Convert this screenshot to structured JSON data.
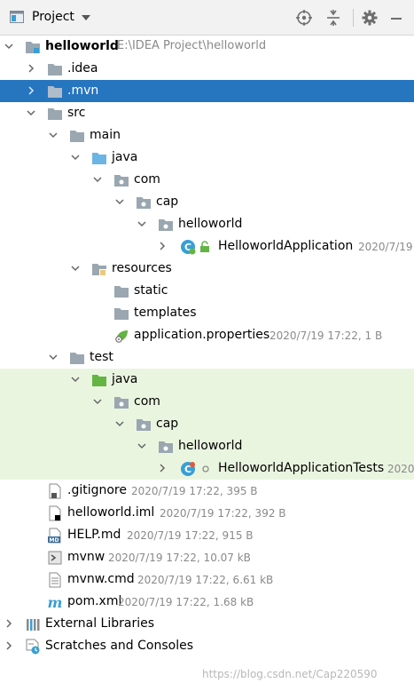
{
  "header": {
    "title": "Project",
    "icons": [
      "project-panel-icon",
      "chevron-down-icon",
      "locate-icon",
      "collapse-all-icon",
      "gear-icon",
      "minimize-icon"
    ]
  },
  "tree": {
    "root_label": "helloworld",
    "root_path": "E:\\IDEA Project\\helloworld",
    "idea": ".idea",
    "mvn": ".mvn",
    "src": "src",
    "main": "main",
    "main_java": "java",
    "main_com": "com",
    "main_cap": "cap",
    "main_pkg": "helloworld",
    "app_class": "HelloworldApplication",
    "app_class_meta": "2020/7/19",
    "resources": "resources",
    "static": "static",
    "templates": "templates",
    "app_props": "application.properties",
    "app_props_meta": "2020/7/19 17:22, 1 B",
    "test": "test",
    "test_java": "java",
    "test_com": "com",
    "test_cap": "cap",
    "test_pkg": "helloworld",
    "test_class": "HelloworldApplicationTests",
    "test_class_meta": "2020",
    "gitignore": ".gitignore",
    "gitignore_meta": "2020/7/19 17:22, 395 B",
    "iml": "helloworld.iml",
    "iml_meta": "2020/7/19 17:22, 392 B",
    "help": "HELP.md",
    "help_meta": "2020/7/19 17:22, 915 B",
    "mvnw": "mvnw",
    "mvnw_meta": "2020/7/19 17:22, 10.07 kB",
    "mvnwcmd": "mvnw.cmd",
    "mvnwcmd_meta": "2020/7/19 17:22, 6.61 kB",
    "pom": "pom.xml",
    "pom_meta": "2020/7/19 17:22, 1.68 kB",
    "ext_libs": "External Libraries",
    "scratches": "Scratches and Consoles"
  },
  "watermark": "https://blog.csdn.net/Cap220590",
  "colors": {
    "selection": "#2675bf",
    "test_background": "#eaf5e0",
    "folder": "#9aa7b0",
    "source_folder": "#6cb4e4",
    "test_folder": "#62b543",
    "meta_text": "#8a8a8a"
  }
}
